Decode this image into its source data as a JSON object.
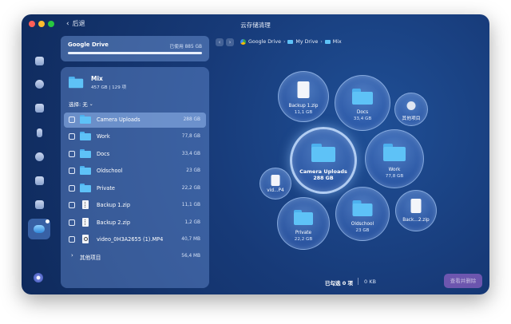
{
  "window": {
    "title": "云存储清理",
    "back_label": "后退"
  },
  "sidebar": {
    "icons": [
      "desktop-icon",
      "disk-icon",
      "hand-icon",
      "lightning-icon",
      "database-icon",
      "applications-icon",
      "shredder-icon",
      "cloud-icon"
    ],
    "active": "cloud-icon",
    "bottom_icon": "assistant-icon"
  },
  "drive": {
    "name": "Google Drive",
    "used_label": "已使用 885 GB"
  },
  "folder": {
    "name": "Mix",
    "size": "457 GB",
    "items": "129 项"
  },
  "select": {
    "label": "选择:",
    "value": "无"
  },
  "rows": [
    {
      "name": "Camera Uploads",
      "size": "288 GB",
      "type": "folder",
      "highlighted": true
    },
    {
      "name": "Work",
      "size": "77,8 GB",
      "type": "folder"
    },
    {
      "name": "Docs",
      "size": "33,4 GB",
      "type": "folder"
    },
    {
      "name": "Oldschool",
      "size": "23 GB",
      "type": "folder"
    },
    {
      "name": "Private",
      "size": "22,2 GB",
      "type": "folder"
    },
    {
      "name": "Backup 1.zip",
      "size": "11,1 GB",
      "type": "zip"
    },
    {
      "name": "Backup 2.zip",
      "size": "1,2 GB",
      "type": "zip"
    },
    {
      "name": "video_0H3A2655 (1).MP4",
      "size": "40,7 MB",
      "type": "video"
    }
  ],
  "other": {
    "label": "其他项目",
    "size": "56,4 MB"
  },
  "breadcrumb": [
    "Google Drive",
    "My Drive",
    "Mix"
  ],
  "bubbles": {
    "backup1": {
      "label": "Backup 1.zip",
      "size": "11,1 GB"
    },
    "docs": {
      "label": "Docs",
      "size": "33,4 GB"
    },
    "other": {
      "label": "其他项目"
    },
    "camera": {
      "label": "Camera Uploads",
      "size": "288 GB"
    },
    "work": {
      "label": "Work",
      "size": "77,8 GB"
    },
    "video": {
      "label": "vid...P4"
    },
    "private": {
      "label": "Private",
      "size": "22,2 GB"
    },
    "oldschool": {
      "label": "Oldschool",
      "size": "23 GB"
    },
    "backup2": {
      "label": "Back...2.zip"
    }
  },
  "status": {
    "selected": "已勾选 0 项",
    "size": "0 KB",
    "review_button": "查看并删除"
  },
  "colors": {
    "accent": "#5ec2f7",
    "window_bg": "#173a78",
    "review_button": "#b46edc"
  }
}
